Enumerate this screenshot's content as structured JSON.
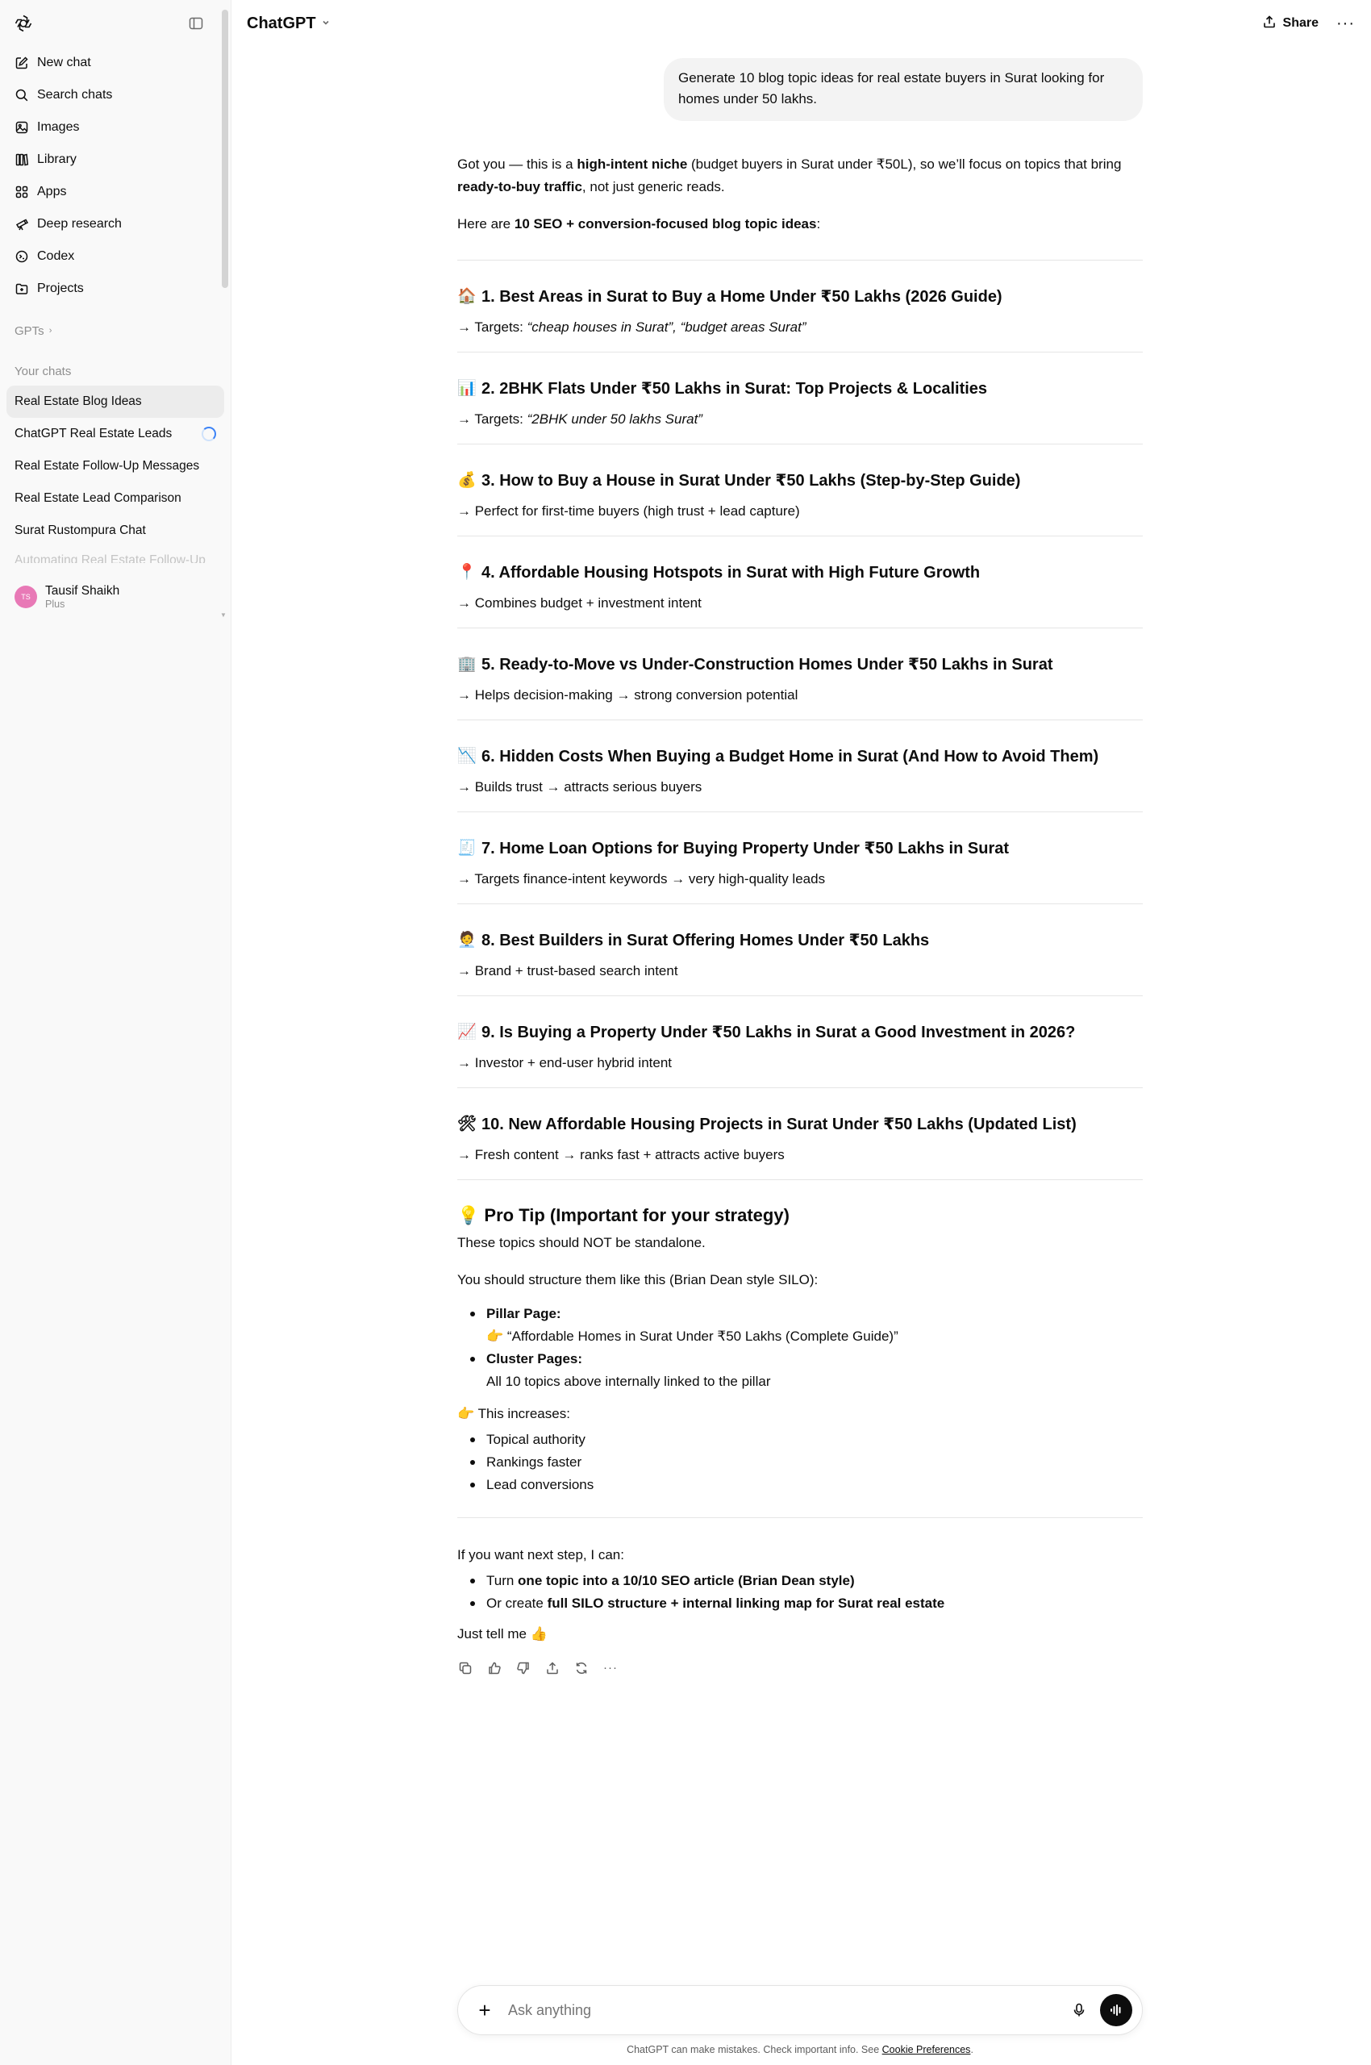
{
  "sidebar": {
    "nav": [
      {
        "label": "New chat",
        "icon": "edit-icon"
      },
      {
        "label": "Search chats",
        "icon": "search-icon"
      },
      {
        "label": "Images",
        "icon": "image-icon"
      },
      {
        "label": "Library",
        "icon": "library-icon"
      },
      {
        "label": "Apps",
        "icon": "apps-icon"
      },
      {
        "label": "Deep research",
        "icon": "telescope-icon"
      },
      {
        "label": "Codex",
        "icon": "codex-icon"
      },
      {
        "label": "Projects",
        "icon": "folder-icon"
      }
    ],
    "gpts_label": "GPTs",
    "your_chats_label": "Your chats",
    "chats": [
      {
        "label": "Real Estate Blog Ideas"
      },
      {
        "label": "ChatGPT Real Estate Leads"
      },
      {
        "label": "Real Estate Follow-Up Messages"
      },
      {
        "label": "Real Estate Lead Comparison"
      },
      {
        "label": "Surat Rustompura Chat"
      },
      {
        "label": "Automating Real Estate Follow-Up"
      }
    ],
    "user": {
      "initials": "TS",
      "name": "Tausif Shaikh",
      "plan": "Plus"
    }
  },
  "header": {
    "model": "ChatGPT",
    "share_label": "Share",
    "more_label": "···"
  },
  "conversation": {
    "user_message": "Generate 10 blog topic ideas for real estate buyers in Surat looking for homes under 50 lakhs.",
    "intro": {
      "p1_a": "Got you — this is a ",
      "p1_b": "high-intent niche",
      "p1_c": " (budget buyers in Surat under ₹50L), so we’ll focus on topics that bring ",
      "p1_d": "ready-to-buy traffic",
      "p1_e": ", not just generic reads.",
      "p2_a": "Here are ",
      "p2_b": "10 SEO + conversion-focused blog topic ideas",
      "p2_c": ":"
    },
    "topics": [
      {
        "emoji": "🏠",
        "title": "1. Best Areas in Surat to Buy a Home Under ₹50 Lakhs (2026 Guide)",
        "sub_prefix": "→ Targets: ",
        "sub_italic": "“cheap houses in Surat”, “budget areas Surat”",
        "sub": ""
      },
      {
        "emoji": "📊",
        "title": "2. 2BHK Flats Under ₹50 Lakhs in Surat: Top Projects & Localities",
        "sub_prefix": "→ Targets: ",
        "sub_italic": "“2BHK under 50 lakhs Surat”",
        "sub": ""
      },
      {
        "emoji": "💰",
        "title": "3. How to Buy a House in Surat Under ₹50 Lakhs (Step-by-Step Guide)",
        "sub_prefix": "",
        "sub_italic": "",
        "sub": "→ Perfect for first-time buyers (high trust + lead capture)"
      },
      {
        "emoji": "📍",
        "title": "4. Affordable Housing Hotspots in Surat with High Future Growth",
        "sub_prefix": "",
        "sub_italic": "",
        "sub": "→ Combines budget + investment intent"
      },
      {
        "emoji": "🏢",
        "title": "5. Ready-to-Move vs Under-Construction Homes Under ₹50 Lakhs in Surat",
        "sub_prefix": "",
        "sub_italic": "",
        "sub": "→ Helps decision-making → strong conversion potential"
      },
      {
        "emoji": "📉",
        "title": "6. Hidden Costs When Buying a Budget Home in Surat (And How to Avoid Them)",
        "sub_prefix": "",
        "sub_italic": "",
        "sub": "→ Builds trust → attracts serious buyers"
      },
      {
        "emoji": "🧾",
        "title": "7. Home Loan Options for Buying Property Under ₹50 Lakhs in Surat",
        "sub_prefix": "",
        "sub_italic": "",
        "sub": "→ Targets finance-intent keywords → very high-quality leads"
      },
      {
        "emoji": "🧑‍💼",
        "title": "8. Best Builders in Surat Offering Homes Under ₹50 Lakhs",
        "sub_prefix": "",
        "sub_italic": "",
        "sub": "→ Brand + trust-based search intent"
      },
      {
        "emoji": "📈",
        "title": "9. Is Buying a Property Under ₹50 Lakhs in Surat a Good Investment in 2026?",
        "sub_prefix": "",
        "sub_italic": "",
        "sub": "→ Investor + end-user hybrid intent"
      },
      {
        "emoji": "🛠",
        "title": "10. New Affordable Housing Projects in Surat Under ₹50 Lakhs (Updated List)",
        "sub_prefix": "",
        "sub_italic": "",
        "sub": "→ Fresh content → ranks fast + attracts active buyers"
      }
    ],
    "protip": {
      "emoji": "💡",
      "title": "Pro Tip (Important for your strategy)",
      "p1": "These topics should NOT be standalone.",
      "p2": "You should structure them like this (Brian Dean style SILO):",
      "pillar_label": "Pillar Page:",
      "pillar_emoji": "👉",
      "pillar_text": "“Affordable Homes in Surat Under ₹50 Lakhs (Complete Guide)”",
      "cluster_label": "Cluster Pages:",
      "cluster_text": "All 10 topics above internally linked to the pillar",
      "increases_emoji": "👉",
      "increases": "This increases:",
      "benefits": [
        "Topical authority",
        "Rankings faster",
        "Lead conversions"
      ]
    },
    "next": {
      "lead": "If you want next step, I can:",
      "opt1_a": "Turn ",
      "opt1_b": "one topic into a 10/10 SEO article (Brian Dean style)",
      "opt2_a": "Or create ",
      "opt2_b": "full SILO structure + internal linking map for Surat real estate",
      "closing": "Just tell me 👍"
    }
  },
  "composer": {
    "placeholder": "Ask anything",
    "disclaimer": "ChatGPT can make mistakes. Check important info. See ",
    "disclaimer_link": "Cookie Preferences",
    "disclaimer_end": "."
  }
}
